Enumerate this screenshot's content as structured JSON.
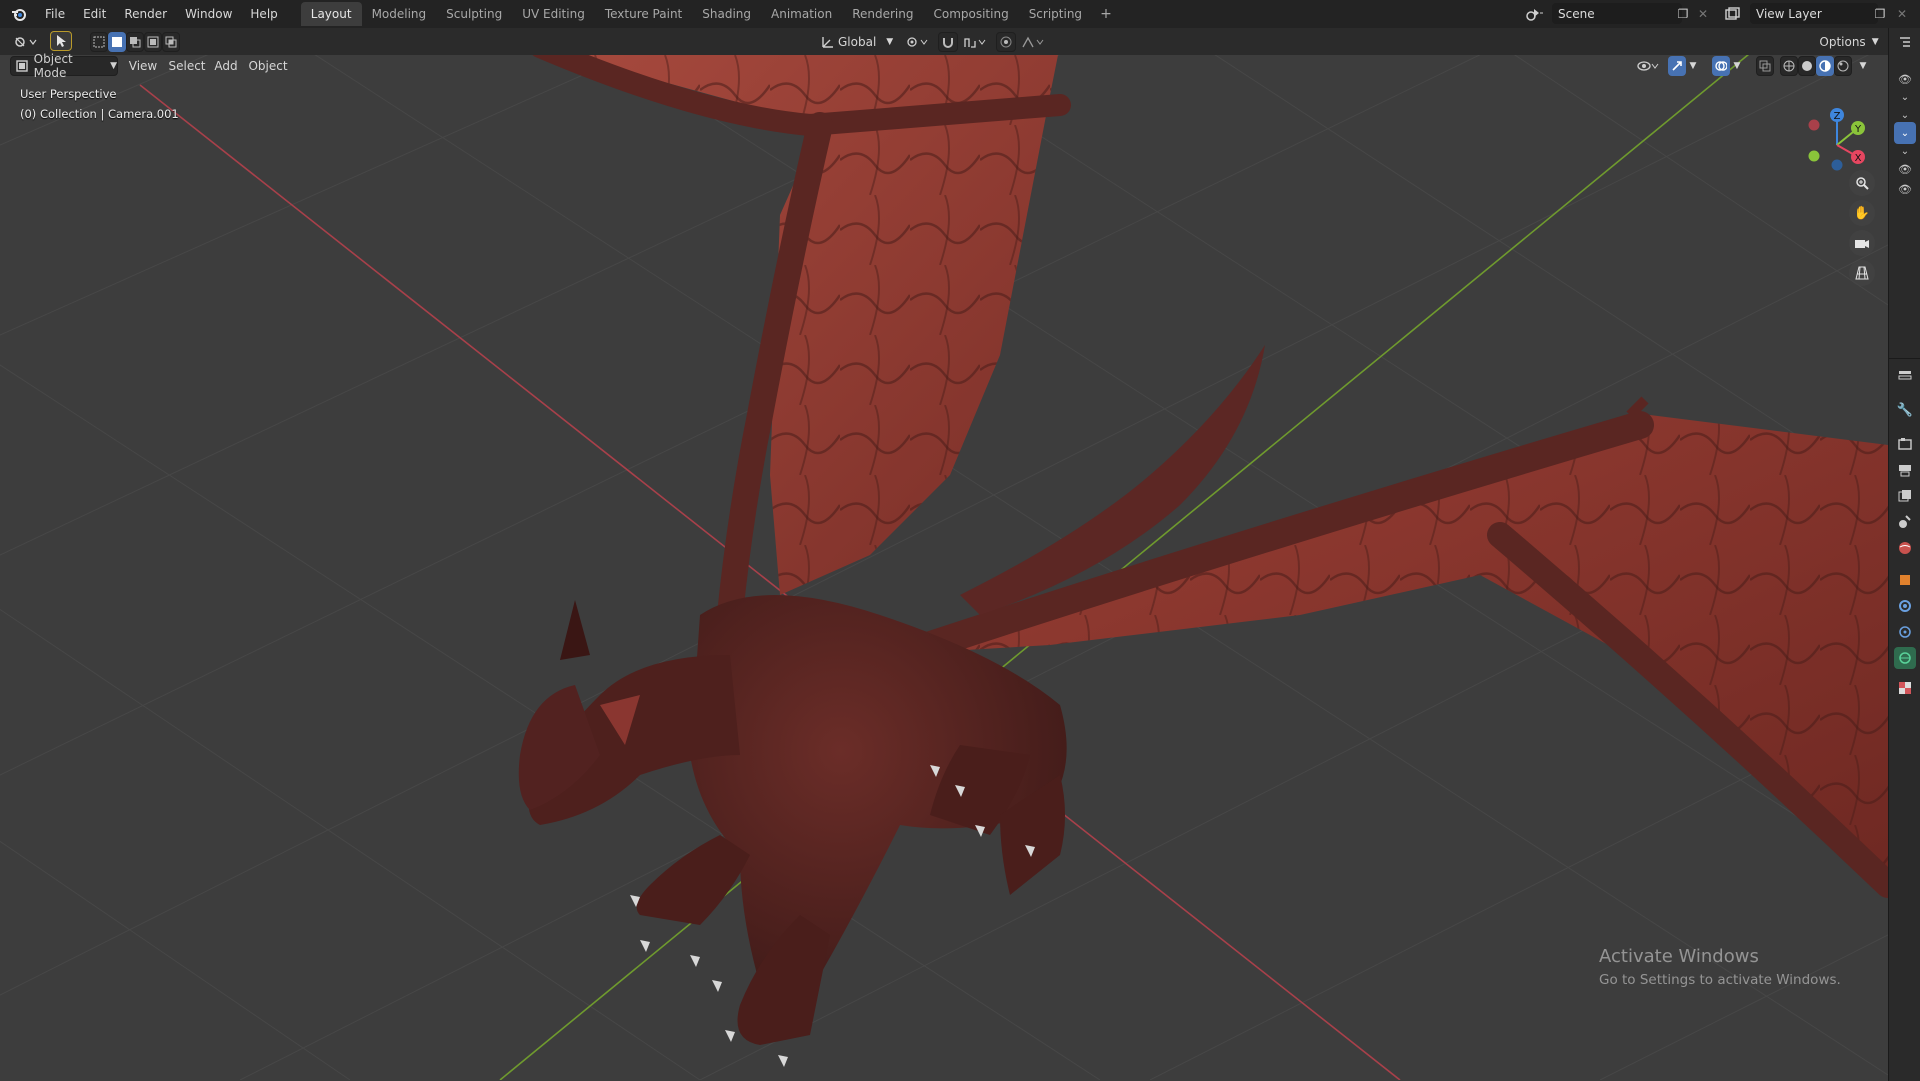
{
  "app": {
    "name": "Blender"
  },
  "menu": [
    "File",
    "Edit",
    "Render",
    "Window",
    "Help"
  ],
  "workspaces": {
    "active": "Layout",
    "tabs": [
      "Layout",
      "Modeling",
      "Sculpting",
      "UV Editing",
      "Texture Paint",
      "Shading",
      "Animation",
      "Rendering",
      "Compositing",
      "Scripting"
    ],
    "add_label": "+"
  },
  "scene": {
    "name": "Scene"
  },
  "view_layer": {
    "name": "View Layer"
  },
  "header": {
    "transform_orientation": "Global",
    "options_label": "Options",
    "mode": "Object Mode",
    "view_menu": [
      "View",
      "Select",
      "Add",
      "Object"
    ]
  },
  "viewport": {
    "perspective_label": "User Perspective",
    "collection_label": "(0) Collection | Camera.001",
    "gizmo_axes": [
      "Z",
      "Y",
      "X"
    ],
    "axis_colors": {
      "x": "#e64660",
      "y": "#8ac43a",
      "z": "#3e86dd"
    }
  },
  "watermark": {
    "title": "Activate Windows",
    "subtitle": "Go to Settings to activate Windows."
  },
  "colors": {
    "accent": "#4772b3",
    "background": "#3d3d3d",
    "topbar": "#232323"
  }
}
